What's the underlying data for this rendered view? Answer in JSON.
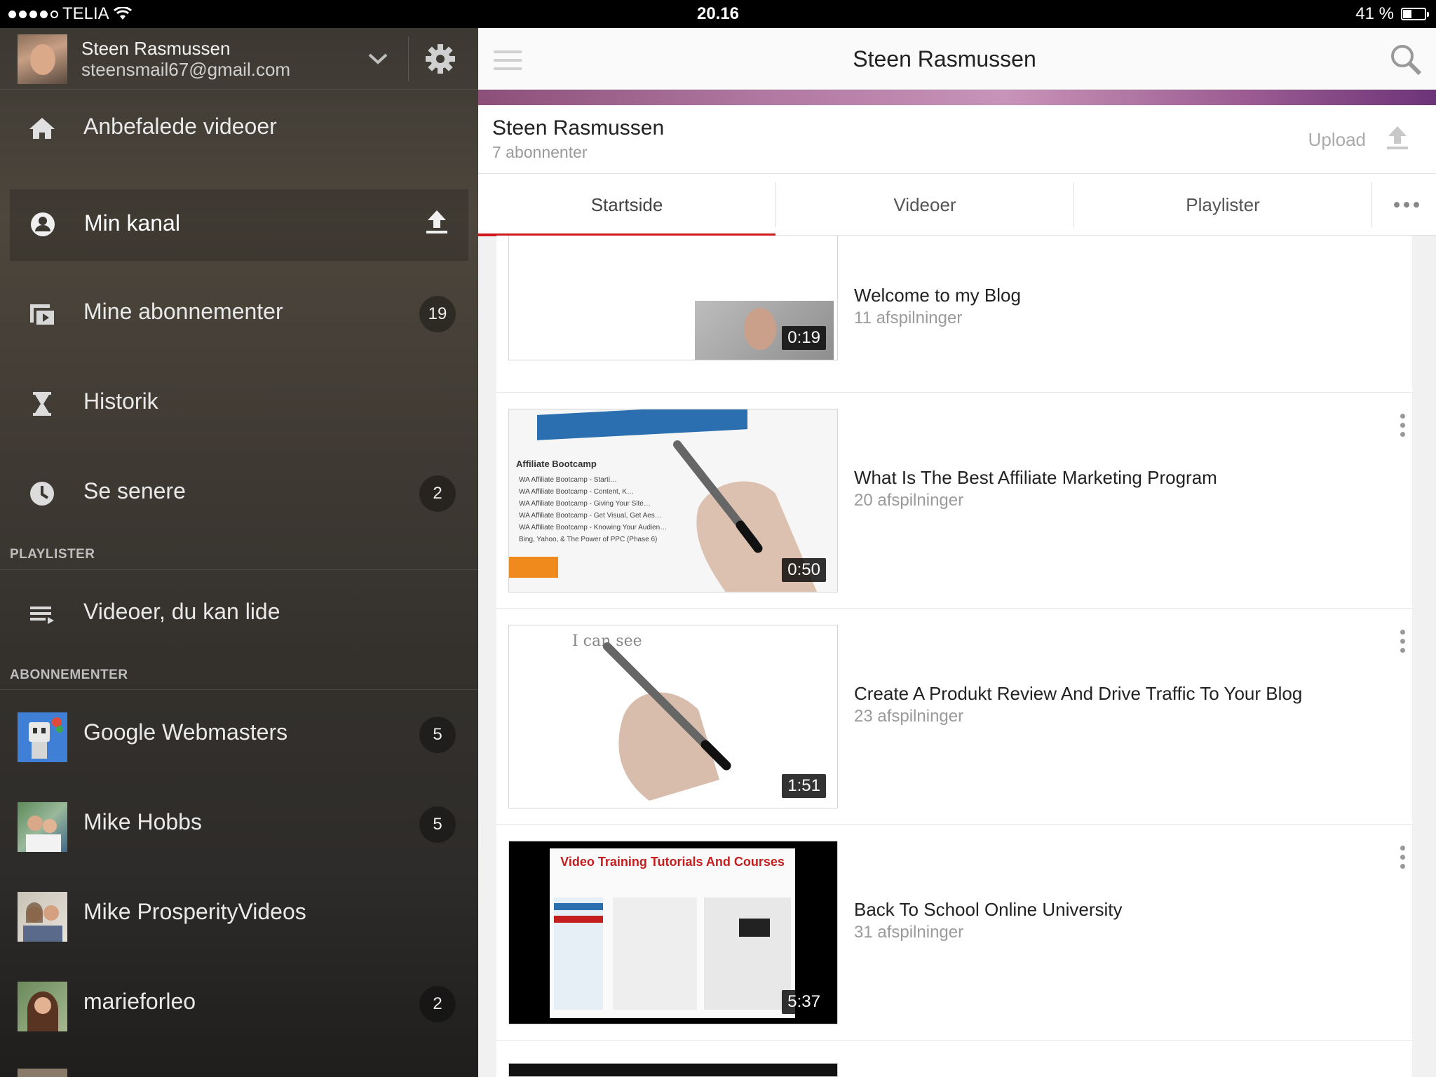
{
  "status_bar": {
    "carrier": "TELIA",
    "time": "20.16",
    "battery_text": "41 %",
    "battery_level": 0.41
  },
  "sidebar": {
    "account": {
      "name": "Steen Rasmussen",
      "email": "steensmail67@gmail.com"
    },
    "nav": [
      {
        "label": "Anbefalede videoer",
        "icon": "home-icon"
      },
      {
        "label": "Min kanal",
        "icon": "person-icon",
        "active": true
      },
      {
        "label": "Mine abonnementer",
        "icon": "subscriptions-icon",
        "badge": "19"
      },
      {
        "label": "Historik",
        "icon": "hourglass-icon"
      },
      {
        "label": "Se senere",
        "icon": "clock-icon",
        "badge": "2"
      }
    ],
    "playlists_header": "PLAYLISTER",
    "playlists": [
      {
        "label": "Videoer, du kan lide",
        "icon": "playlist-icon"
      }
    ],
    "subscriptions_header": "ABONNEMENTER",
    "subscriptions": [
      {
        "label": "Google Webmasters",
        "badge": "5"
      },
      {
        "label": "Mike Hobbs",
        "badge": "5"
      },
      {
        "label": "Mike ProsperityVideos"
      },
      {
        "label": "marieforleo",
        "badge": "2"
      }
    ]
  },
  "main": {
    "title": "Steen Rasmussen",
    "channel": {
      "name": "Steen Rasmussen",
      "subscribers": "7 abonnenter",
      "upload_label": "Upload"
    },
    "tabs": [
      "Startside",
      "Videoer",
      "Playlister"
    ],
    "videos": [
      {
        "title": "Welcome to my Blog",
        "views": "11 afspilninger",
        "duration": "0:19"
      },
      {
        "title": "What Is The Best Affiliate Marketing Program",
        "views": "20 afspilninger",
        "duration": "0:50",
        "thumb_heading": "Affiliate Bootcamp",
        "thumb_lines": [
          "WA Affiliate Bootcamp - Starti…",
          "WA Affiliate Bootcamp - Content, K…",
          "WA Affiliate Bootcamp - Giving Your Site…",
          "WA Affiliate Bootcamp - Get Visual, Get Aes…",
          "WA Affiliate Bootcamp - Knowing Your Audien…",
          "Bing, Yahoo, & The Power of PPC (Phase 6)"
        ]
      },
      {
        "title": "Create A Produkt Review And Drive Traffic To Your Blog",
        "views": "23 afspilninger",
        "duration": "1:51",
        "thumb_text": "I can see"
      },
      {
        "title": "Back To School Online University",
        "views": "31 afspilninger",
        "duration": "5:37",
        "thumb_heading": "Video Training Tutorials And Courses"
      }
    ]
  },
  "colors": {
    "accent_red": "#cc181e",
    "banner_purple": "#a06a96"
  }
}
